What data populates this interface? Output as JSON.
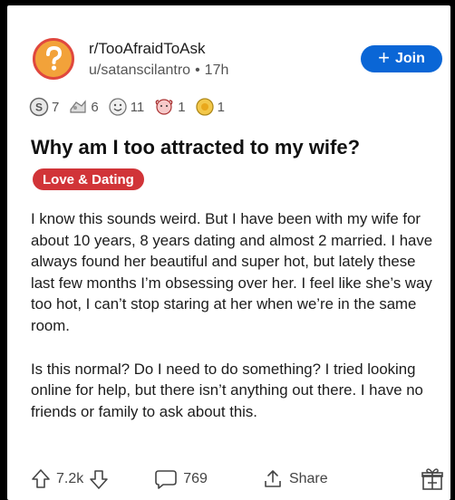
{
  "post": {
    "subreddit": "r/TooAfraidToAsk",
    "author": "u/satanscilantro",
    "separator": "•",
    "age": "17h",
    "join_label": "Join",
    "awards": [
      {
        "icon": "silver-award-icon",
        "count": "7"
      },
      {
        "icon": "helpful-award-icon",
        "count": "6"
      },
      {
        "icon": "wholesome-award-icon",
        "count": "11"
      },
      {
        "icon": "hugz-award-icon",
        "count": "1"
      },
      {
        "icon": "gold-sun-award-icon",
        "count": "1"
      }
    ],
    "title": "Why am I too attracted to my wife?",
    "flair": "Love & Dating",
    "body": [
      "I know this sounds weird. But I have been with my wife for about 10 years, 8 years dating and almost 2 married. I have always found her beautiful and super hot, but lately  these last few months I’m obsessing over her. I feel like she’s way too hot, I can’t stop staring at her when we’re in the same room.",
      "Is this normal? Do I need to do something? I tried looking online for help, but there isn’t anything out there. I have no friends or family to ask about this."
    ],
    "votes": "7.2k",
    "comments": "769",
    "share_label": "Share"
  },
  "colors": {
    "join_bg": "#0a66d6",
    "flair_bg": "#d13438",
    "avatar_bg": "#f2a23a",
    "avatar_border": "#e0473e"
  }
}
